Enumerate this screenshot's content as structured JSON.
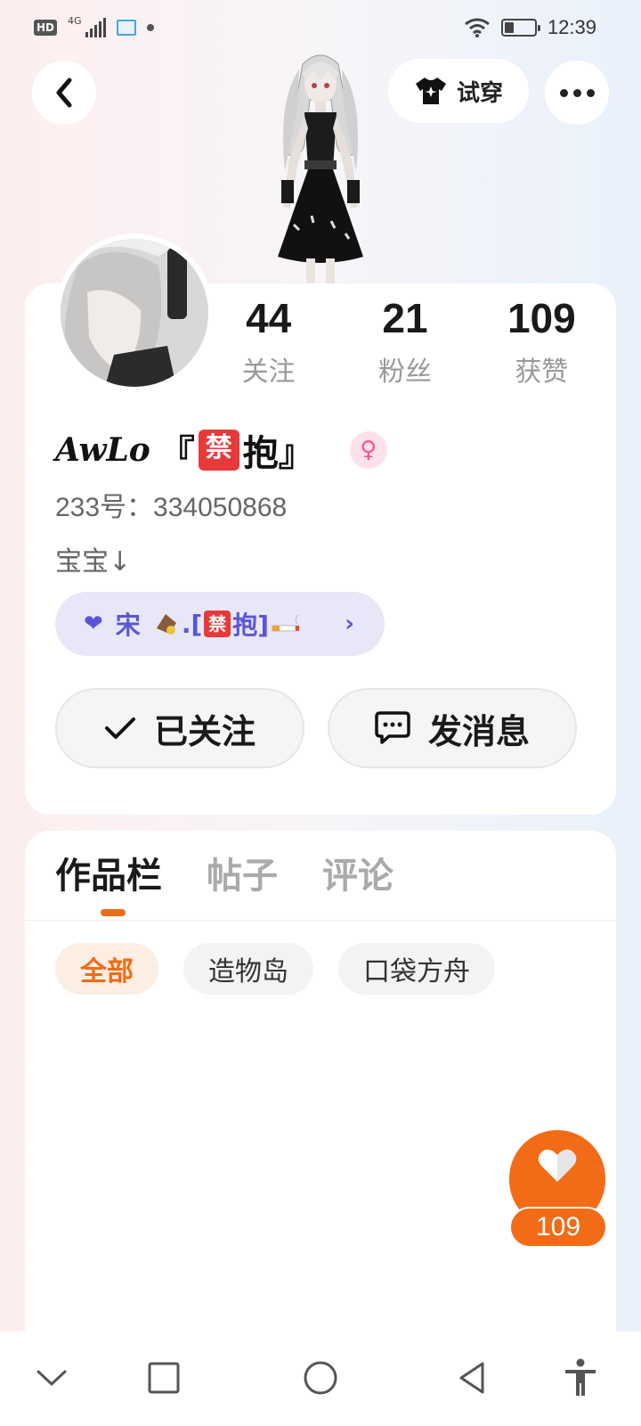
{
  "status_bar": {
    "hd_badge": "HD",
    "network": "4G",
    "time": "12:39",
    "battery_level": 0.3
  },
  "top_bar": {
    "try_on_label": "试穿"
  },
  "stats": [
    {
      "value": "44",
      "label": "关注"
    },
    {
      "value": "21",
      "label": "粉丝"
    },
    {
      "value": "109",
      "label": "获赞"
    }
  ],
  "profile": {
    "name_script": "AwLo",
    "name_open": "『",
    "name_ban": "禁",
    "name_tail": "抱』",
    "gender_symbol": "♀",
    "uid": "233号：334050868",
    "bio": "宝宝↓"
  },
  "guild": {
    "heart": "❤",
    "name_prefix": "宋",
    "name_mid": ".[",
    "name_ban": "禁",
    "name_end": "抱]",
    "arrow": "›"
  },
  "actions": {
    "follow_label": "已关注",
    "message_label": "发消息"
  },
  "tabs": [
    {
      "label": "作品栏",
      "active": true
    },
    {
      "label": "帖子",
      "active": false
    },
    {
      "label": "评论",
      "active": false
    }
  ],
  "filters": [
    {
      "label": "全部",
      "active": true
    },
    {
      "label": "造物岛",
      "active": false
    },
    {
      "label": "口袋方舟",
      "active": false
    }
  ],
  "like_fab": {
    "count": "109"
  },
  "colors": {
    "accent": "#f26b16",
    "guild_text": "#5b55d6",
    "guild_bg": "#e7e7f8"
  }
}
